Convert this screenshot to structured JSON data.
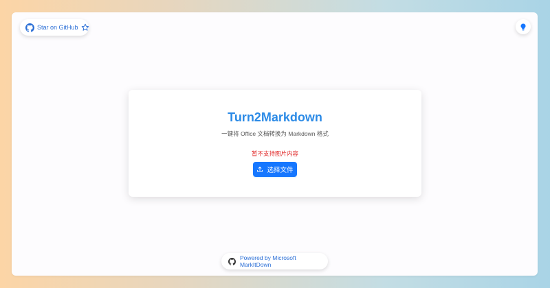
{
  "header": {
    "github_star_label": "Star on GitHub"
  },
  "card": {
    "title": "Turn2Markdown",
    "subtitle": "一键将 Office 文档转换为 Markdown 格式",
    "notice": "暂不支持图片内容",
    "upload_label": "选择文件"
  },
  "footer": {
    "powered_label": "Powered by Microsoft MarkItDown"
  },
  "colors": {
    "accent": "#1677ff",
    "title": "#2b8ae6",
    "notice": "#e02424"
  },
  "icons": {
    "github": "github-icon",
    "star": "star-icon",
    "theme": "bulb-icon",
    "upload": "upload-icon"
  }
}
